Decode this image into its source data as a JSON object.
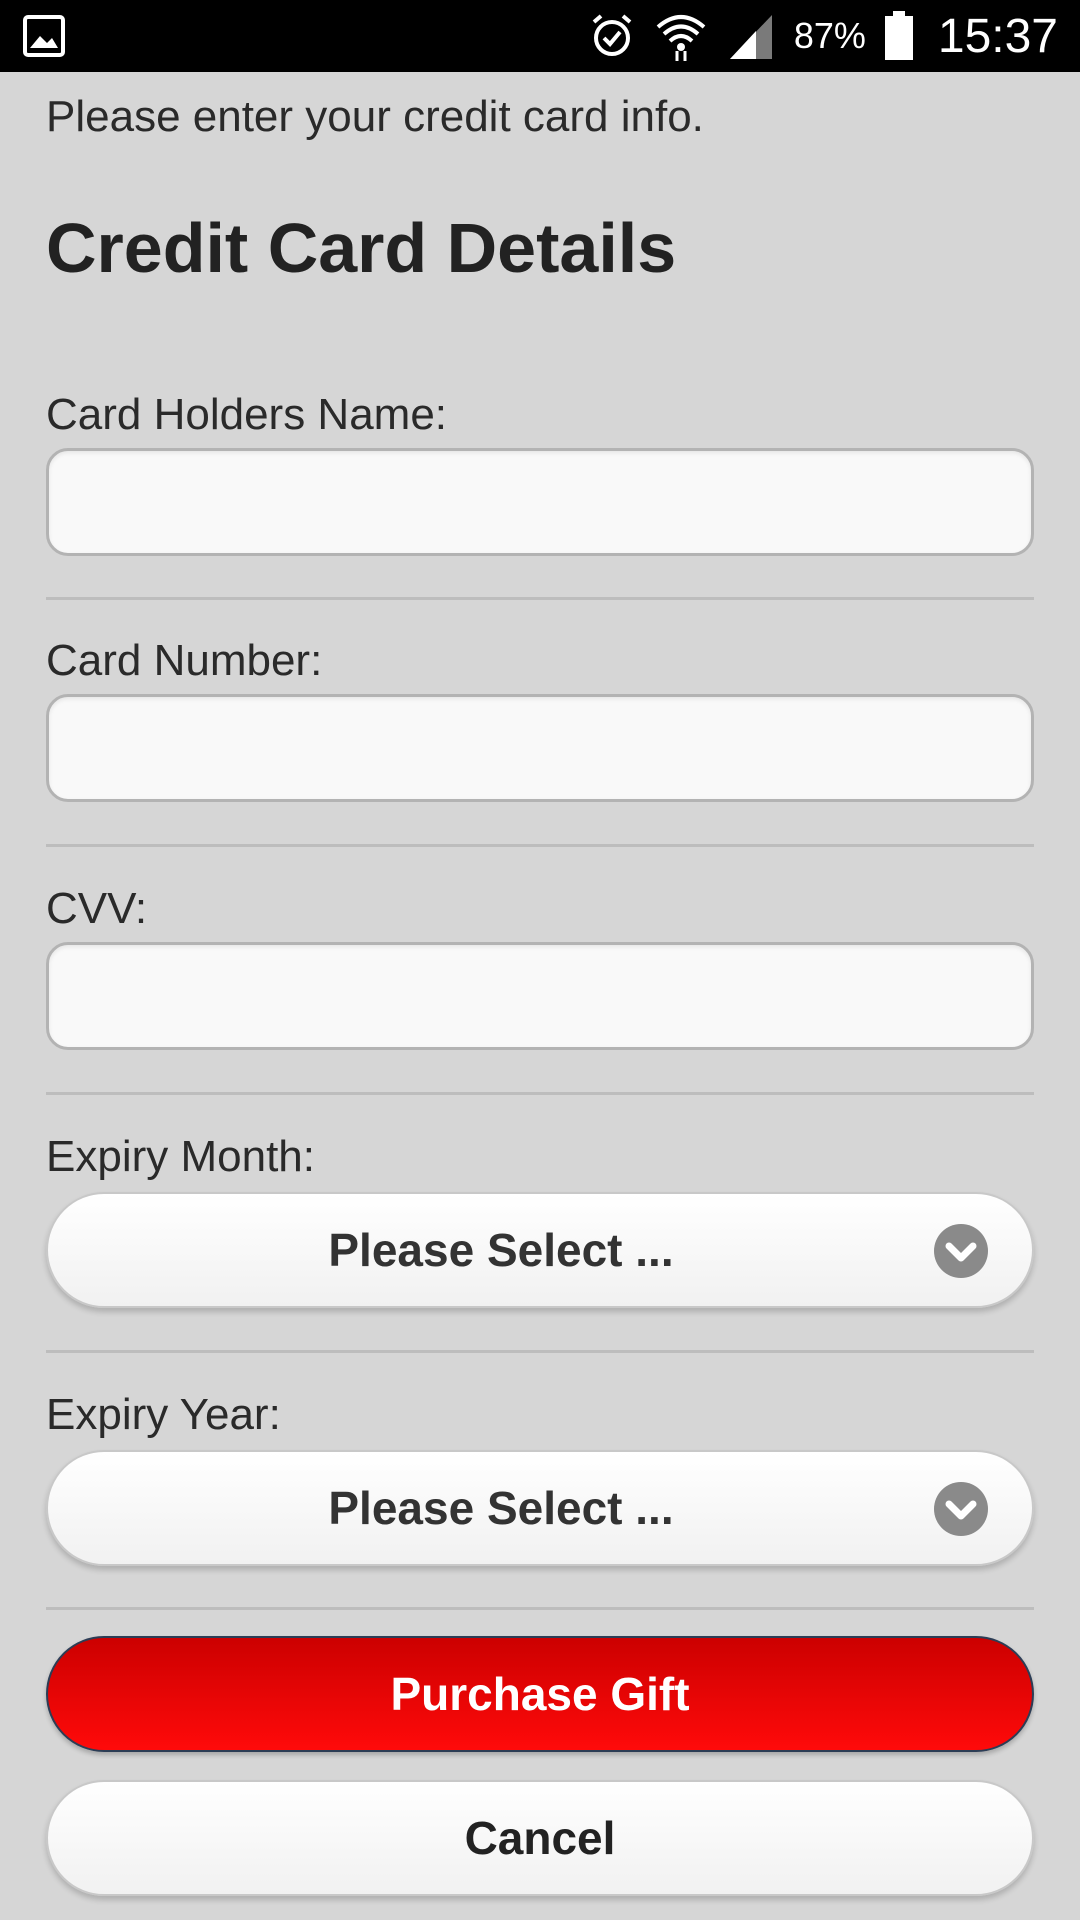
{
  "status_bar": {
    "left_icon": "gallery-notification-icon",
    "alarm_icon": "alarm-icon",
    "wifi_icon": "wifi-icon",
    "signal_icon": "cell-signal-icon",
    "battery_percent": "87%",
    "battery_icon": "battery-icon",
    "time": "15:37"
  },
  "form": {
    "intro": "Please enter your credit card info.",
    "title": "Credit Card Details",
    "card_holder_label": "Card Holders Name:",
    "card_holder_value": "",
    "card_number_label": "Card Number:",
    "card_number_value": "",
    "cvv_label": "CVV:",
    "cvv_value": "",
    "expiry_month_label": "Expiry Month:",
    "expiry_month_selected": "Please Select ...",
    "expiry_year_label": "Expiry Year:",
    "expiry_year_selected": "Please Select ...",
    "select_icon": "chevron-down-circle-icon"
  },
  "actions": {
    "purchase_label": "Purchase Gift",
    "cancel_label": "Cancel"
  },
  "colors": {
    "page_background": "#d6d6d6",
    "primary_button": "#e60000",
    "status_bar": "#000000"
  }
}
